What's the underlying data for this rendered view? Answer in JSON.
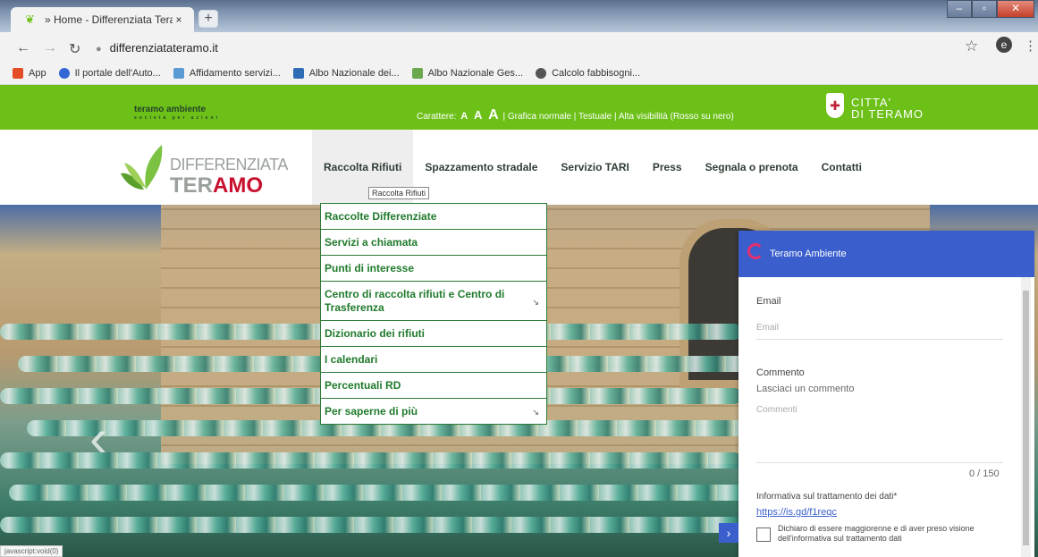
{
  "browser": {
    "tab_title": "» Home - Differenziata Teramo",
    "tab_close": "×",
    "new_tab": "+",
    "url": "differenziatateramo.it",
    "window_controls": [
      "–",
      "▫",
      "✕"
    ],
    "account_letter": "e"
  },
  "bookmarks": [
    {
      "label": "App",
      "color": "#e34c26"
    },
    {
      "label": "Il portale dell'Auto...",
      "color": "#3367d6"
    },
    {
      "label": "Affidamento servizi...",
      "color": "#5b9bd5"
    },
    {
      "label": "Albo Nazionale dei...",
      "color": "#2e6db4"
    },
    {
      "label": "Albo Nazionale Ges...",
      "color": "#6aa84f"
    },
    {
      "label": "Calcolo fabbisogni...",
      "color": "#555555"
    }
  ],
  "topbar": {
    "logo_text": "teramo ambiente",
    "logo_sub": "società per azioni",
    "characters_label": "Carattere:",
    "font_sizes": [
      "A",
      "A",
      "A"
    ],
    "links": "| Grafica normale | Testuale | Alta visibilità (Rosso su nero)",
    "city_line1": "CITTA'",
    "city_line2": "DI TERAMO"
  },
  "site_logo": {
    "top": "DIFFERENZIATA",
    "bottom_a": "TER",
    "bottom_b": "AMO"
  },
  "nav": {
    "items": [
      "Raccolta Rifiuti",
      "Spazzamento stradale",
      "Servizio TARI",
      "Press",
      "Segnala o prenota",
      "Contatti"
    ],
    "tooltip": "Raccolta Rifiuti"
  },
  "dropdown": {
    "items": [
      {
        "label": "Raccolte Differenziate",
        "sub": ""
      },
      {
        "label": "Servizi a chiamata",
        "sub": ""
      },
      {
        "label": "Punti di interesse",
        "sub": ""
      },
      {
        "label": "Centro di raccolta rifiuti e Centro di Trasferenza",
        "sub": "↘"
      },
      {
        "label": "Dizionario dei rifiuti",
        "sub": ""
      },
      {
        "label": "I calendari",
        "sub": ""
      },
      {
        "label": "Percentuali RD",
        "sub": ""
      },
      {
        "label": "Per saperne di più",
        "sub": "↘"
      }
    ]
  },
  "chat": {
    "title": "Teramo Ambiente",
    "email_label": "Email",
    "email_placeholder": "Email",
    "comment_label": "Commento",
    "comment_hint": "Lasciaci un commento",
    "comment_placeholder": "Commenti",
    "counter": "0 / 150",
    "privacy_label": "Informativa sul trattamento dei dati*",
    "privacy_link": "https://is.gd/f1reqc",
    "consent_text": "Dichiaro di essere maggiorenne e di aver preso visione dell'informativa sul trattamento dati",
    "toggle": "›"
  },
  "status_text": "javascript:void(0)",
  "colors": {
    "green": "#6cc018",
    "dark_green": "#1f7a2b",
    "chat_blue": "#3a5fcd",
    "red": "#c8102e"
  }
}
